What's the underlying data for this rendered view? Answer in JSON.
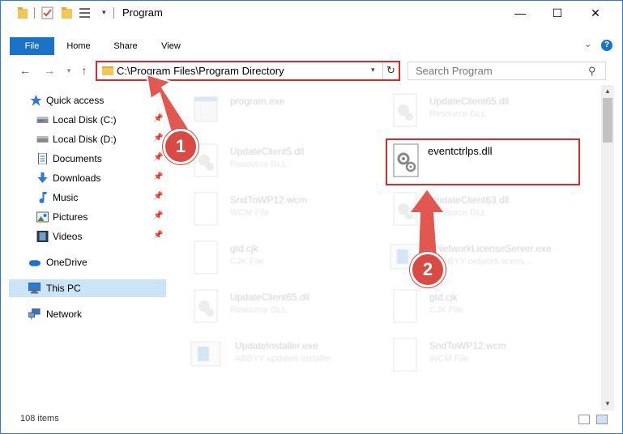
{
  "window": {
    "title": "Program",
    "minimize_icon": "minimize-icon",
    "maximize_icon": "maximize-icon",
    "close_icon": "close-icon",
    "minimize_glyph": "—",
    "maximize_glyph": "☐",
    "close_glyph": "✕"
  },
  "ribbon": {
    "tabs": [
      "File",
      "Home",
      "Share",
      "View"
    ],
    "help_glyph": "?",
    "collapse_glyph": "⌄"
  },
  "address": {
    "path": "C:\\Program Files\\Program Directory",
    "dropdown_glyph": "▾",
    "refresh_glyph": "↻",
    "back_glyph": "←",
    "forward_glyph": "→",
    "recent_glyph": "▾",
    "up_glyph": "↑"
  },
  "search": {
    "placeholder": "Search Program",
    "icon_glyph": "⚲"
  },
  "nav": {
    "pin_glyph": "📌",
    "items": [
      {
        "label": "Quick access",
        "icon": "star-icon"
      },
      {
        "label": "Local Disk (C:)",
        "icon": "drive-icon",
        "pinned": true
      },
      {
        "label": "Local Disk (D:)",
        "icon": "drive-icon",
        "pinned": true
      },
      {
        "label": "Documents",
        "icon": "documents-icon",
        "pinned": true
      },
      {
        "label": "Downloads",
        "icon": "downloads-icon",
        "pinned": true
      },
      {
        "label": "Music",
        "icon": "music-icon",
        "pinned": true
      },
      {
        "label": "Pictures",
        "icon": "pictures-icon",
        "pinned": true
      },
      {
        "label": "Videos",
        "icon": "videos-icon",
        "pinned": true
      },
      {
        "label": "OneDrive",
        "icon": "onedrive-icon"
      },
      {
        "label": "This PC",
        "icon": "pc-icon",
        "selected": true
      },
      {
        "label": "Network",
        "icon": "network-icon"
      }
    ]
  },
  "files": [
    {
      "name": "program.exe",
      "type": "",
      "icon": "exe-icon"
    },
    {
      "name": "UpdateClient65.dll",
      "type": "Resource DLL",
      "icon": "dll-icon"
    },
    {
      "name": "UpdateClient5.dll",
      "type": "Resource DLL",
      "icon": "dll-icon"
    },
    {
      "name": "eventctrlps.dll",
      "type": "",
      "icon": "dll-gear-icon",
      "highlighted": true
    },
    {
      "name": "SndToWP12.wcm",
      "type": "WCM File",
      "icon": "blank-file-icon"
    },
    {
      "name": "UpdateClient63.dll",
      "type": "Resource DLL",
      "icon": "dll-icon"
    },
    {
      "name": "gtd.cjk",
      "type": "CJK File",
      "icon": "blank-file-icon"
    },
    {
      "name": "NetworkLicenseServer.exe",
      "type": "ABBYY network licens...",
      "icon": "app-icon"
    },
    {
      "name": "UpdateClient65.dll",
      "type": "Resource DLL",
      "icon": "dll-icon"
    },
    {
      "name": "gtd.cjk",
      "type": "CJK File",
      "icon": "blank-file-icon"
    },
    {
      "name": "UpdateInstaller.exe",
      "type": "ABBYY updates installer",
      "icon": "app-icon"
    },
    {
      "name": "SndToWP12.wcm",
      "type": "WCM File",
      "icon": "blank-file-icon"
    }
  ],
  "status": {
    "items_count": "108 items"
  },
  "callouts": {
    "one": "1",
    "two": "2"
  },
  "colors": {
    "accent": "#1a73c9",
    "highlight": "#d72c2c",
    "callout": "#d94a45",
    "selection": "#cce4f7"
  }
}
